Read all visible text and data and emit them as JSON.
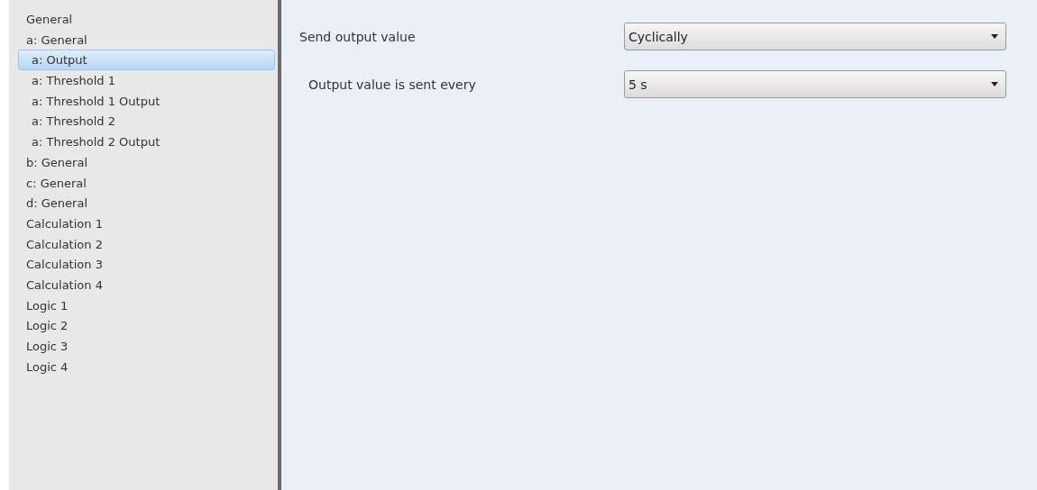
{
  "sidebar": {
    "items": [
      {
        "label": "General",
        "selected": false
      },
      {
        "label": "a: General",
        "selected": false,
        "children": [
          {
            "label": "a: Output",
            "selected": true
          },
          {
            "label": "a: Threshold 1",
            "selected": false
          },
          {
            "label": "a: Threshold 1 Output",
            "selected": false
          },
          {
            "label": "a: Threshold 2",
            "selected": false
          },
          {
            "label": "a: Threshold 2 Output",
            "selected": false
          }
        ]
      },
      {
        "label": "b: General",
        "selected": false
      },
      {
        "label": "c: General",
        "selected": false
      },
      {
        "label": "d: General",
        "selected": false
      },
      {
        "label": "Calculation 1",
        "selected": false
      },
      {
        "label": "Calculation 2",
        "selected": false
      },
      {
        "label": "Calculation 3",
        "selected": false
      },
      {
        "label": "Calculation 4",
        "selected": false
      },
      {
        "label": "Logic 1",
        "selected": false
      },
      {
        "label": "Logic 2",
        "selected": false
      },
      {
        "label": "Logic 3",
        "selected": false
      },
      {
        "label": "Logic 4",
        "selected": false
      }
    ]
  },
  "parameters": [
    {
      "label": "Send output value",
      "value": "Cyclically",
      "children": [
        {
          "label": "Output value is sent every",
          "value": "5 s"
        }
      ]
    }
  ]
}
